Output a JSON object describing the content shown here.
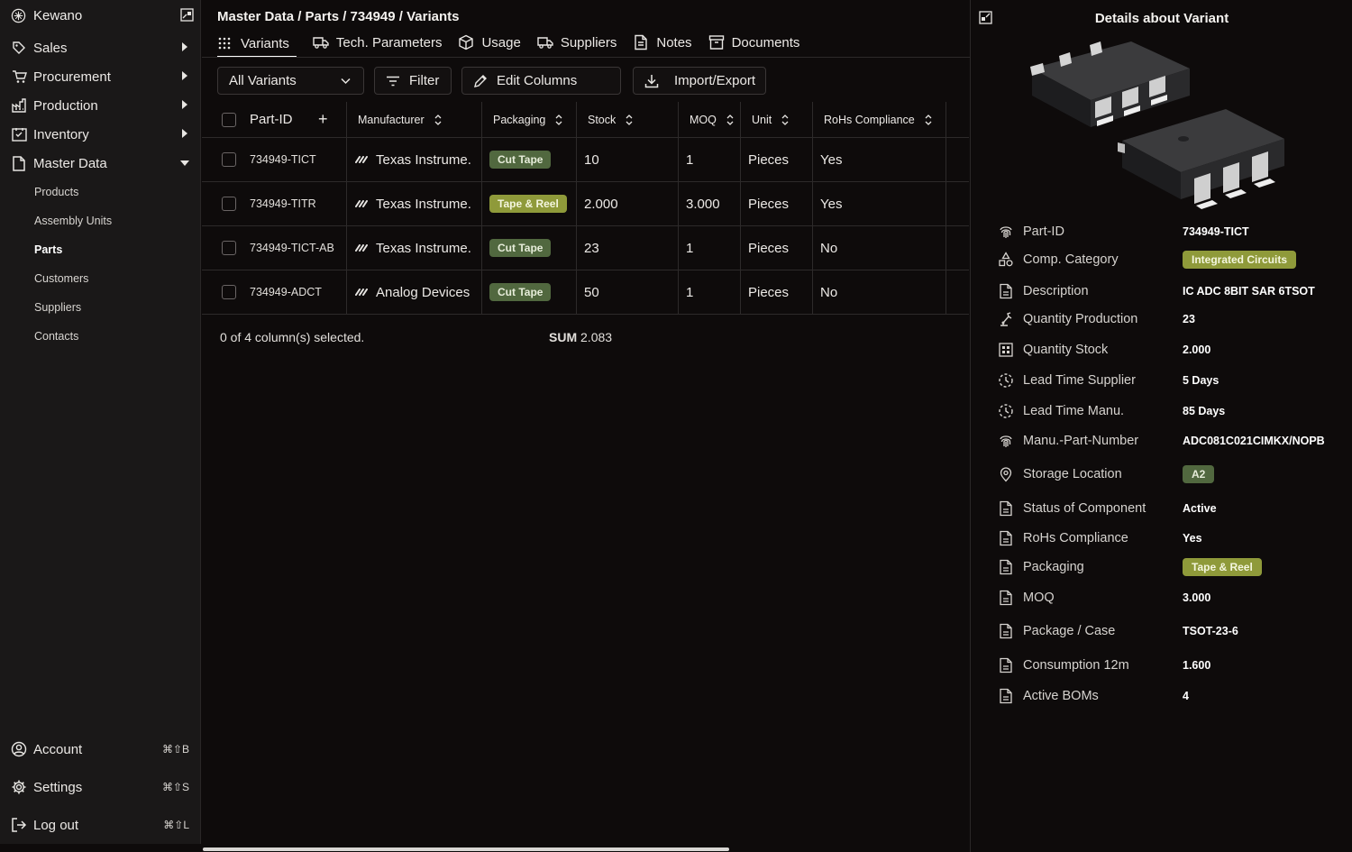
{
  "sidebar": {
    "brand": "Kewano",
    "nav": [
      {
        "label": "Sales",
        "icon": "tag-icon"
      },
      {
        "label": "Procurement",
        "icon": "cart-icon"
      },
      {
        "label": "Production",
        "icon": "factory-icon"
      },
      {
        "label": "Inventory",
        "icon": "inventory-icon"
      },
      {
        "label": "Master Data",
        "icon": "document-icon"
      }
    ],
    "sub": [
      "Products",
      "Assembly Units",
      "Parts",
      "Customers",
      "Suppliers",
      "Contacts"
    ],
    "active_sub": "Parts",
    "footer": [
      {
        "label": "Account",
        "shortcut": "⌘⇧B"
      },
      {
        "label": "Settings",
        "shortcut": "⌘⇧S"
      },
      {
        "label": "Log out",
        "shortcut": "⌘⇧L"
      }
    ]
  },
  "main": {
    "breadcrumb": "Master Data / Parts / 734949 / Variants",
    "tabs": [
      {
        "label": "Variants",
        "icon": "grid-dots-icon"
      },
      {
        "label": "Tech. Parameters",
        "icon": "truck-icon"
      },
      {
        "label": "Usage",
        "icon": "box-icon"
      },
      {
        "label": "Suppliers",
        "icon": "truck-icon"
      },
      {
        "label": "Notes",
        "icon": "note-icon"
      },
      {
        "label": "Documents",
        "icon": "archive-icon"
      }
    ],
    "toolbar": {
      "variant_select": "All Variants",
      "filter": "Filter",
      "edit_columns": "Edit Columns",
      "import_export": "Import/Export"
    },
    "table": {
      "headers": [
        "Part-ID",
        "Manufacturer",
        "Packaging",
        "Stock",
        "MOQ",
        "Unit",
        "RoHs Compliance"
      ],
      "add_symbol": "+",
      "rows": [
        {
          "part_id": "734949-TICT",
          "manufacturer": "Texas Instrume.",
          "packaging": "Cut Tape",
          "stock": "10",
          "moq": "1",
          "unit": "Pieces",
          "rohs": "Yes"
        },
        {
          "part_id": "734949-TITR",
          "manufacturer": "Texas Instrume.",
          "packaging": "Tape & Reel",
          "stock": "2.000",
          "moq": "3.000",
          "unit": "Pieces",
          "rohs": "Yes"
        },
        {
          "part_id": "734949-TICT-AB",
          "manufacturer": "Texas Instrume.",
          "packaging": "Cut Tape",
          "stock": "23",
          "moq": "1",
          "unit": "Pieces",
          "rohs": "No"
        },
        {
          "part_id": "734949-ADCT",
          "manufacturer": "Analog Devices",
          "packaging": "Cut Tape",
          "stock": "50",
          "moq": "1",
          "unit": "Pieces",
          "rohs": "No"
        }
      ]
    },
    "footer": {
      "selected": "0 of 4 column(s) selected.",
      "sum_label": "SUM",
      "sum_value": "2.083"
    }
  },
  "panel": {
    "title": "Details about Variant",
    "props": [
      {
        "key": "Part-ID",
        "value": "734949-TICT",
        "icon": "fingerprint-icon"
      },
      {
        "key": "Comp. Category",
        "value": "Integrated Circuits",
        "icon": "shapes-icon",
        "badge": "olive"
      },
      {
        "key": "Description",
        "value": "IC ADC 8BIT SAR 6TSOT",
        "icon": "file-icon"
      },
      {
        "key": "Quantity Production",
        "value": "23",
        "icon": "robot-arm-icon"
      },
      {
        "key": "Quantity Stock",
        "value": "2.000",
        "icon": "warehouse-icon"
      },
      {
        "key": "Lead Time Supplier",
        "value": "5 Days",
        "icon": "clock-dashed-icon"
      },
      {
        "key": "Lead Time Manu.",
        "value": "85 Days",
        "icon": "clock-dashed-icon"
      },
      {
        "key": "Manu.-Part-Number",
        "value": "ADC081C021CIMKX/NOPB",
        "icon": "fingerprint-icon"
      },
      {
        "key": "Storage Location",
        "value": "A2",
        "icon": "map-pin-icon",
        "badge": "green"
      },
      {
        "key": "Status of Component",
        "value": "Active",
        "icon": "file-icon"
      },
      {
        "key": "RoHs Compliance",
        "value": "Yes",
        "icon": "file-icon"
      },
      {
        "key": "Packaging",
        "value": "Tape & Reel",
        "icon": "file-icon",
        "badge": "olive"
      },
      {
        "key": "MOQ",
        "value": "3.000",
        "icon": "file-icon"
      },
      {
        "key": "Package / Case",
        "value": "TSOT-23-6",
        "icon": "file-icon"
      },
      {
        "key": "Consumption 12m",
        "value": "1.600",
        "icon": "file-icon"
      },
      {
        "key": "Active BOMs",
        "value": "4",
        "icon": "file-icon"
      }
    ]
  },
  "colors": {
    "background": "#0e0b0b",
    "sidebar": "#1a1818",
    "badge_cut_tape": "#51683f",
    "badge_tape_reel": "#8f9a3a"
  }
}
